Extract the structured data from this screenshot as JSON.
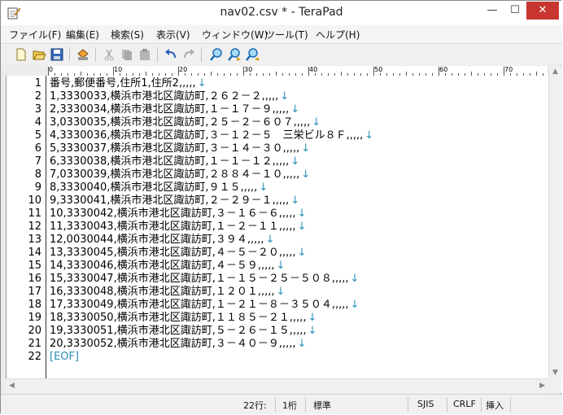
{
  "window": {
    "title": "nav02.csv * - TeraPad",
    "minimize": "—",
    "maximize": "☐",
    "close": "✕"
  },
  "menu": [
    "ファイル(F)",
    "編集(E)",
    "検索(S)",
    "表示(V)",
    "ウィンドウ(W)",
    "ツール(T)",
    "ヘルプ(H)"
  ],
  "toolbar": {
    "icons": [
      "new-file-icon",
      "open-file-icon",
      "save-icon",
      "print-icon",
      "cut-icon",
      "copy-icon",
      "paste-icon",
      "undo-icon",
      "redo-icon",
      "find-icon",
      "find-next-icon",
      "find-prev-icon"
    ]
  },
  "ruler": {
    "labels": [
      "0",
      "10",
      "20",
      "30",
      "40",
      "50",
      "60",
      "70"
    ]
  },
  "editor": {
    "lines": [
      "番号,郵便番号,住所1,住所2,,,,,",
      "1,3330033,横浜市港北区諏訪町,２６２－２,,,,,",
      "2,3330034,横浜市港北区諏訪町,１－１７－９,,,,,",
      "3,0330035,横浜市港北区諏訪町,２５－２－６０７,,,,,",
      "4,3330036,横浜市港北区諏訪町,３－１２－５　三栄ビル８Ｆ,,,,,",
      "5,3330037,横浜市港北区諏訪町,３－１４－３０,,,,,",
      "6,3330038,横浜市港北区諏訪町,１－１－１２,,,,,",
      "7,0330039,横浜市港北区諏訪町,２８８４－１０,,,,,",
      "8,3330040,横浜市港北区諏訪町,９１５,,,,,",
      "9,3330041,横浜市港北区諏訪町,２－２９－１,,,,,",
      "10,3330042,横浜市港北区諏訪町,３－１６－６,,,,,",
      "11,3330043,横浜市港北区諏訪町,１－２－１１,,,,,",
      "12,0030044,横浜市港北区諏訪町,３９４,,,,,",
      "13,3330045,横浜市港北区諏訪町,４－５－２０,,,,,",
      "14,3330046,横浜市港北区諏訪町,４－５９,,,,,",
      "15,3330047,横浜市港北区諏訪町,１－１５－２５－５０８,,,,,",
      "16,3330048,横浜市港北区諏訪町,１２０１,,,,,",
      "17,3330049,横浜市港北区諏訪町,１－２１－８－３５０４,,,,,",
      "18,3330050,横浜市港北区諏訪町,１１８５－２１,,,,,",
      "19,3330051,横浜市港北区諏訪町,５－２６－１５,,,,,",
      "20,3330052,横浜市港北区諏訪町,３－４０－９,,,,,"
    ],
    "return_mark": "↓",
    "eof": "[EOF]"
  },
  "status": {
    "line": "22行:",
    "col": "1桁",
    "mode": "標準",
    "encoding": "SJIS",
    "newline": "CRLF",
    "insert": "挿入"
  }
}
